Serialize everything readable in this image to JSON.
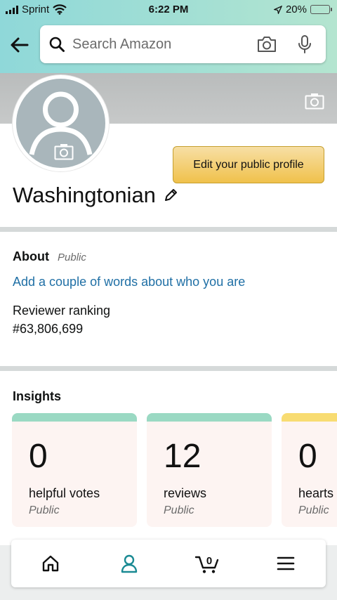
{
  "status_bar": {
    "carrier": "Sprint",
    "time": "6:22 PM",
    "battery": "20%",
    "battery_level": 0.2
  },
  "search": {
    "placeholder": "Search Amazon"
  },
  "profile": {
    "name": "Washingtonian",
    "edit_button": "Edit your public profile"
  },
  "about": {
    "title": "About",
    "visibility": "Public",
    "prompt_link": "Add a couple of words about who you are",
    "ranking_label": "Reviewer ranking",
    "ranking_value": "#63,806,699"
  },
  "insights": {
    "title": "Insights",
    "cards": [
      {
        "value": "0",
        "label": "helpful votes",
        "visibility": "Public",
        "color": "#9ad9c3"
      },
      {
        "value": "12",
        "label": "reviews",
        "visibility": "Public",
        "color": "#9ad9c3"
      },
      {
        "value": "0",
        "label": "hearts",
        "visibility": "Public",
        "color": "#f8dc72"
      }
    ]
  },
  "bottom_nav": {
    "items": [
      "home-icon",
      "account-icon",
      "cart-icon",
      "menu-icon"
    ],
    "active": "account-icon",
    "cart_count": "0"
  },
  "colors": {
    "accent": "#1a8a93",
    "link": "#1f6fa5",
    "button": "#f0c14b"
  }
}
